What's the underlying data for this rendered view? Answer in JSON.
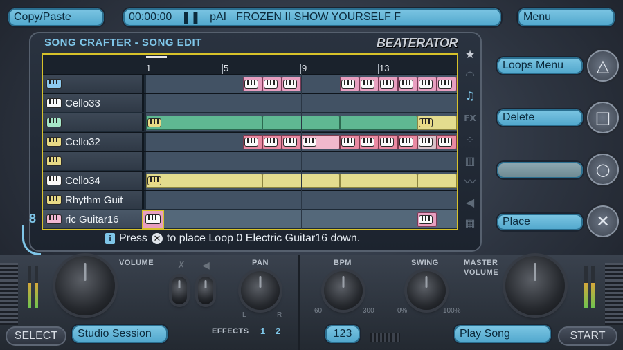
{
  "top_bar": {
    "copy_paste": "Copy/Paste",
    "time": "00:00:00",
    "song_status": "pAI",
    "song_name": "FROZEN II SHOW YOURSELF F",
    "menu": "Menu"
  },
  "panel": {
    "title": "SONG CRAFTER - SONG EDIT",
    "brand": "BEATERATOR",
    "bar_numbers": [
      "1",
      "5",
      "9",
      "13"
    ],
    "page_number": "8"
  },
  "tracks": [
    {
      "label": "",
      "icon_color": "blue"
    },
    {
      "label": "Cello33",
      "icon_color": "white"
    },
    {
      "label": "",
      "icon_color": "green"
    },
    {
      "label": "Cello32",
      "icon_color": "yellow"
    },
    {
      "label": "",
      "icon_color": "yellow"
    },
    {
      "label": "Cello34",
      "icon_color": "white"
    },
    {
      "label": "Rhythm Guit",
      "icon_color": "yellow"
    },
    {
      "label": "ric Guitar16",
      "icon_color": "pink"
    }
  ],
  "hint": {
    "press": "Press",
    "rest": "to place Loop 0   Electric Guitar16 down."
  },
  "side_menu": {
    "loops_menu": "Loops Menu",
    "delete": "Delete",
    "empty": "",
    "place": "Place"
  },
  "controls": {
    "volume_label": "VOLUME",
    "pan_label": "PAN",
    "pan_left": "L",
    "pan_right": "R",
    "bpm_label": "BPM",
    "bpm_min": "60",
    "bpm_max": "300",
    "swing_label": "SWING",
    "swing_min": "0%",
    "swing_max": "100%",
    "master_volume_label_1": "MASTER",
    "master_volume_label_2": "VOLUME",
    "effects_label": "EFFECTS",
    "effect_1": "1",
    "effect_2": "2"
  },
  "bottom_bar": {
    "select": "SELECT",
    "studio_session": "Studio Session",
    "bpm_value": "123",
    "play_song": "Play Song",
    "start": "START"
  },
  "colors": {
    "accent": "#7ec7e4",
    "grid_border": "#d7c22a",
    "clip_pink": "#e89fc0",
    "clip_green": "#5fb892",
    "clip_yellow": "#e3dc8e"
  }
}
